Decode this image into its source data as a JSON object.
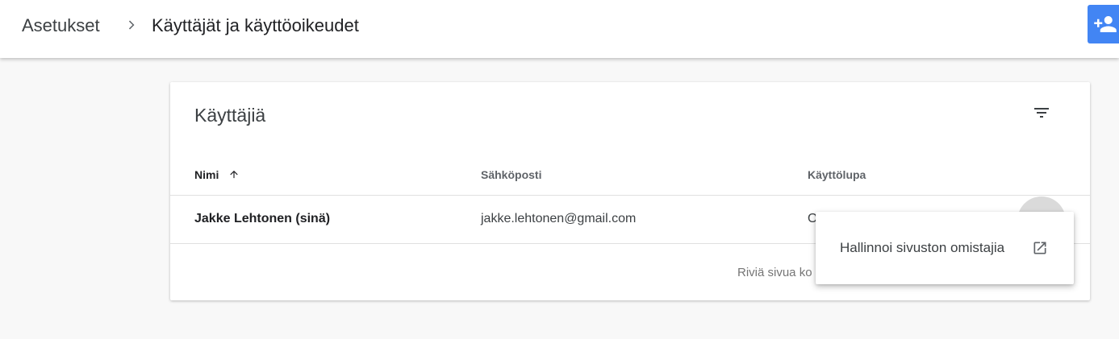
{
  "header": {
    "breadcrumb_root": "Asetukset",
    "title": "Käyttäjät ja käyttöoikeudet",
    "add_user_icon": "person-add-icon",
    "accent_color": "#4285f4"
  },
  "users_card": {
    "title": "Käyttäjiä",
    "filter_icon": "filter-icon",
    "columns": {
      "name": "Nimi",
      "email": "Sähköposti",
      "permission": "Käyttölupa"
    },
    "sort_icon": "arrow-up-icon",
    "rows": [
      {
        "name": "Jakke Lehtonen (sinä)",
        "email": "jakke.lehtonen@gmail.com",
        "permission": "O"
      }
    ],
    "footer": {
      "rows_per_page_label": "Riviä sivua ko"
    }
  },
  "context_menu": {
    "items": [
      {
        "label": "Hallinnoi sivuston omistajia",
        "icon": "open-in-new-icon"
      }
    ]
  }
}
